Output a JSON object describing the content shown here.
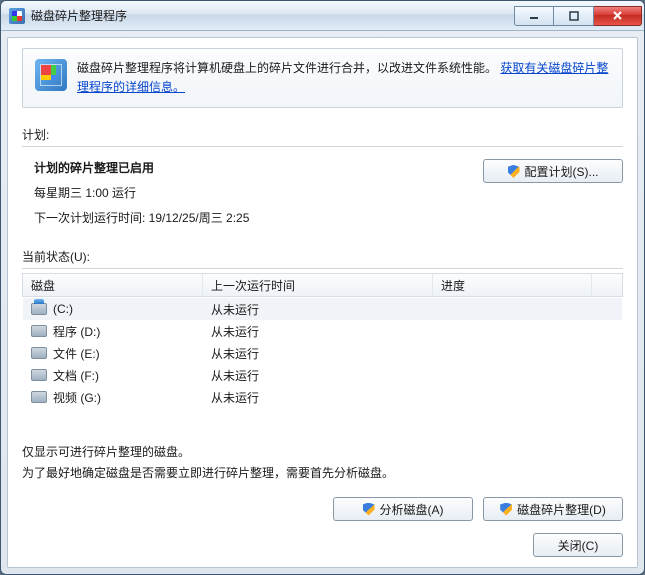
{
  "window": {
    "title": "磁盘碎片整理程序"
  },
  "banner": {
    "text_before_link": "磁盘碎片整理程序将计算机硬盘上的碎片文件进行合并，以改进文件系统性能。",
    "link_text": "获取有关磁盘碎片整理程序的详细信息。"
  },
  "schedule": {
    "section_label": "计划:",
    "title": "计划的碎片整理已启用",
    "line1": "每星期三  1:00 运行",
    "line2": "下一次计划运行时间: 19/12/25/周三 2:25",
    "configure_btn": "配置计划(S)..."
  },
  "status_label": "当前状态(U):",
  "columns": {
    "disk": "磁盘",
    "last": "上一次运行时间",
    "progress": "进度"
  },
  "rows": [
    {
      "name": "(C:)",
      "last": "从未运行",
      "primary": true
    },
    {
      "name": "程序 (D:)",
      "last": "从未运行",
      "primary": false
    },
    {
      "name": "文件 (E:)",
      "last": "从未运行",
      "primary": false
    },
    {
      "name": "文档 (F:)",
      "last": "从未运行",
      "primary": false
    },
    {
      "name": "视频 (G:)",
      "last": "从未运行",
      "primary": false
    }
  ],
  "notes": {
    "line1": "仅显示可进行碎片整理的磁盘。",
    "line2": "为了最好地确定磁盘是否需要立即进行碎片整理，需要首先分析磁盘。"
  },
  "buttons": {
    "analyze": "分析磁盘(A)",
    "defrag": "磁盘碎片整理(D)",
    "close": "关闭(C)"
  }
}
